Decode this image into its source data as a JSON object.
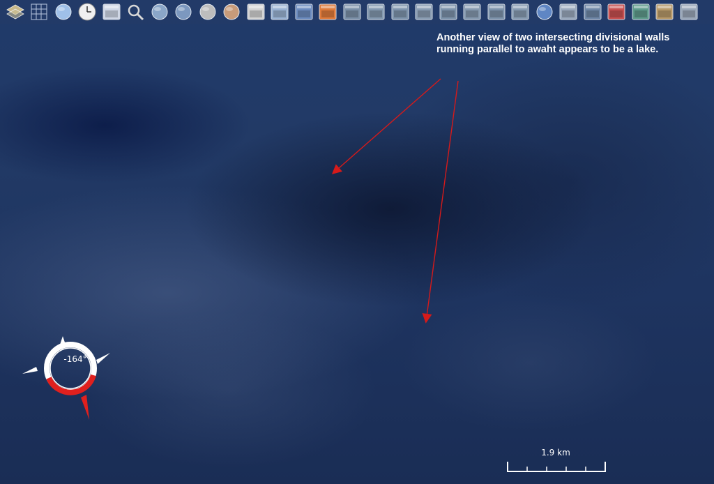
{
  "viewport": {
    "description_free": true
  },
  "toolbar": {
    "buttons": [
      {
        "name": "layers-icon",
        "color": "#c9b98a"
      },
      {
        "name": "latlong-grid-icon",
        "color": "#b9c8e0"
      },
      {
        "name": "globe-grid-icon",
        "color": "#9fc0e8"
      },
      {
        "name": "clock-icon",
        "color": "#e6e6e6"
      },
      {
        "name": "camera-icon",
        "color": "#cfd7e6"
      },
      {
        "name": "search-icon",
        "color": "#d8d8d8"
      },
      {
        "name": "earth-small-icon",
        "color": "#8aa6c8"
      },
      {
        "name": "earth-medium-icon",
        "color": "#7c98bf"
      },
      {
        "name": "moon-icon",
        "color": "#bdbdbd"
      },
      {
        "name": "mars-icon",
        "color": "#c79b7a"
      },
      {
        "name": "satellite-add-icon",
        "color": "#d4d4d4"
      },
      {
        "name": "wms-earth-icon",
        "color": "#9ab3d4"
      },
      {
        "name": "wms-browser-icon",
        "color": "#6c8cc0"
      },
      {
        "name": "heatmap-icon",
        "color": "#e07b3b"
      },
      {
        "name": "landsat-icon-1",
        "color": "#7b90a8"
      },
      {
        "name": "landsat-icon-2",
        "color": "#8499b0"
      },
      {
        "name": "landsat-icon-3",
        "color": "#7f95ad"
      },
      {
        "name": "landsat-icon-4",
        "color": "#8a9db3"
      },
      {
        "name": "landsat-icon-5",
        "color": "#7c92aa"
      },
      {
        "name": "landsat-icon-6",
        "color": "#8599af"
      },
      {
        "name": "landsat-icon-7",
        "color": "#7d93ab"
      },
      {
        "name": "landsat-icon-8",
        "color": "#889cb2"
      },
      {
        "name": "blue-marble-icon",
        "color": "#5f86c4"
      },
      {
        "name": "map-icon",
        "color": "#9aa9bd"
      },
      {
        "name": "terrain-icon",
        "color": "#6f87a7"
      },
      {
        "name": "flags-icon",
        "color": "#c85050"
      },
      {
        "name": "places-icon",
        "color": "#5f9c8c"
      },
      {
        "name": "usa-map-icon",
        "color": "#b89a6a"
      },
      {
        "name": "grid-tool-icon",
        "color": "#9aa7b8"
      }
    ]
  },
  "annotation": {
    "text": "Another view of two intersecting  divisional walls running parallel to awaht appears to be a lake."
  },
  "compass": {
    "heading": "-164°"
  },
  "scale_bar": {
    "label": "1.9 km"
  },
  "colors": {
    "arrow": "#d61a1a",
    "compass_red": "#e0201e",
    "text": "#ffffff"
  }
}
